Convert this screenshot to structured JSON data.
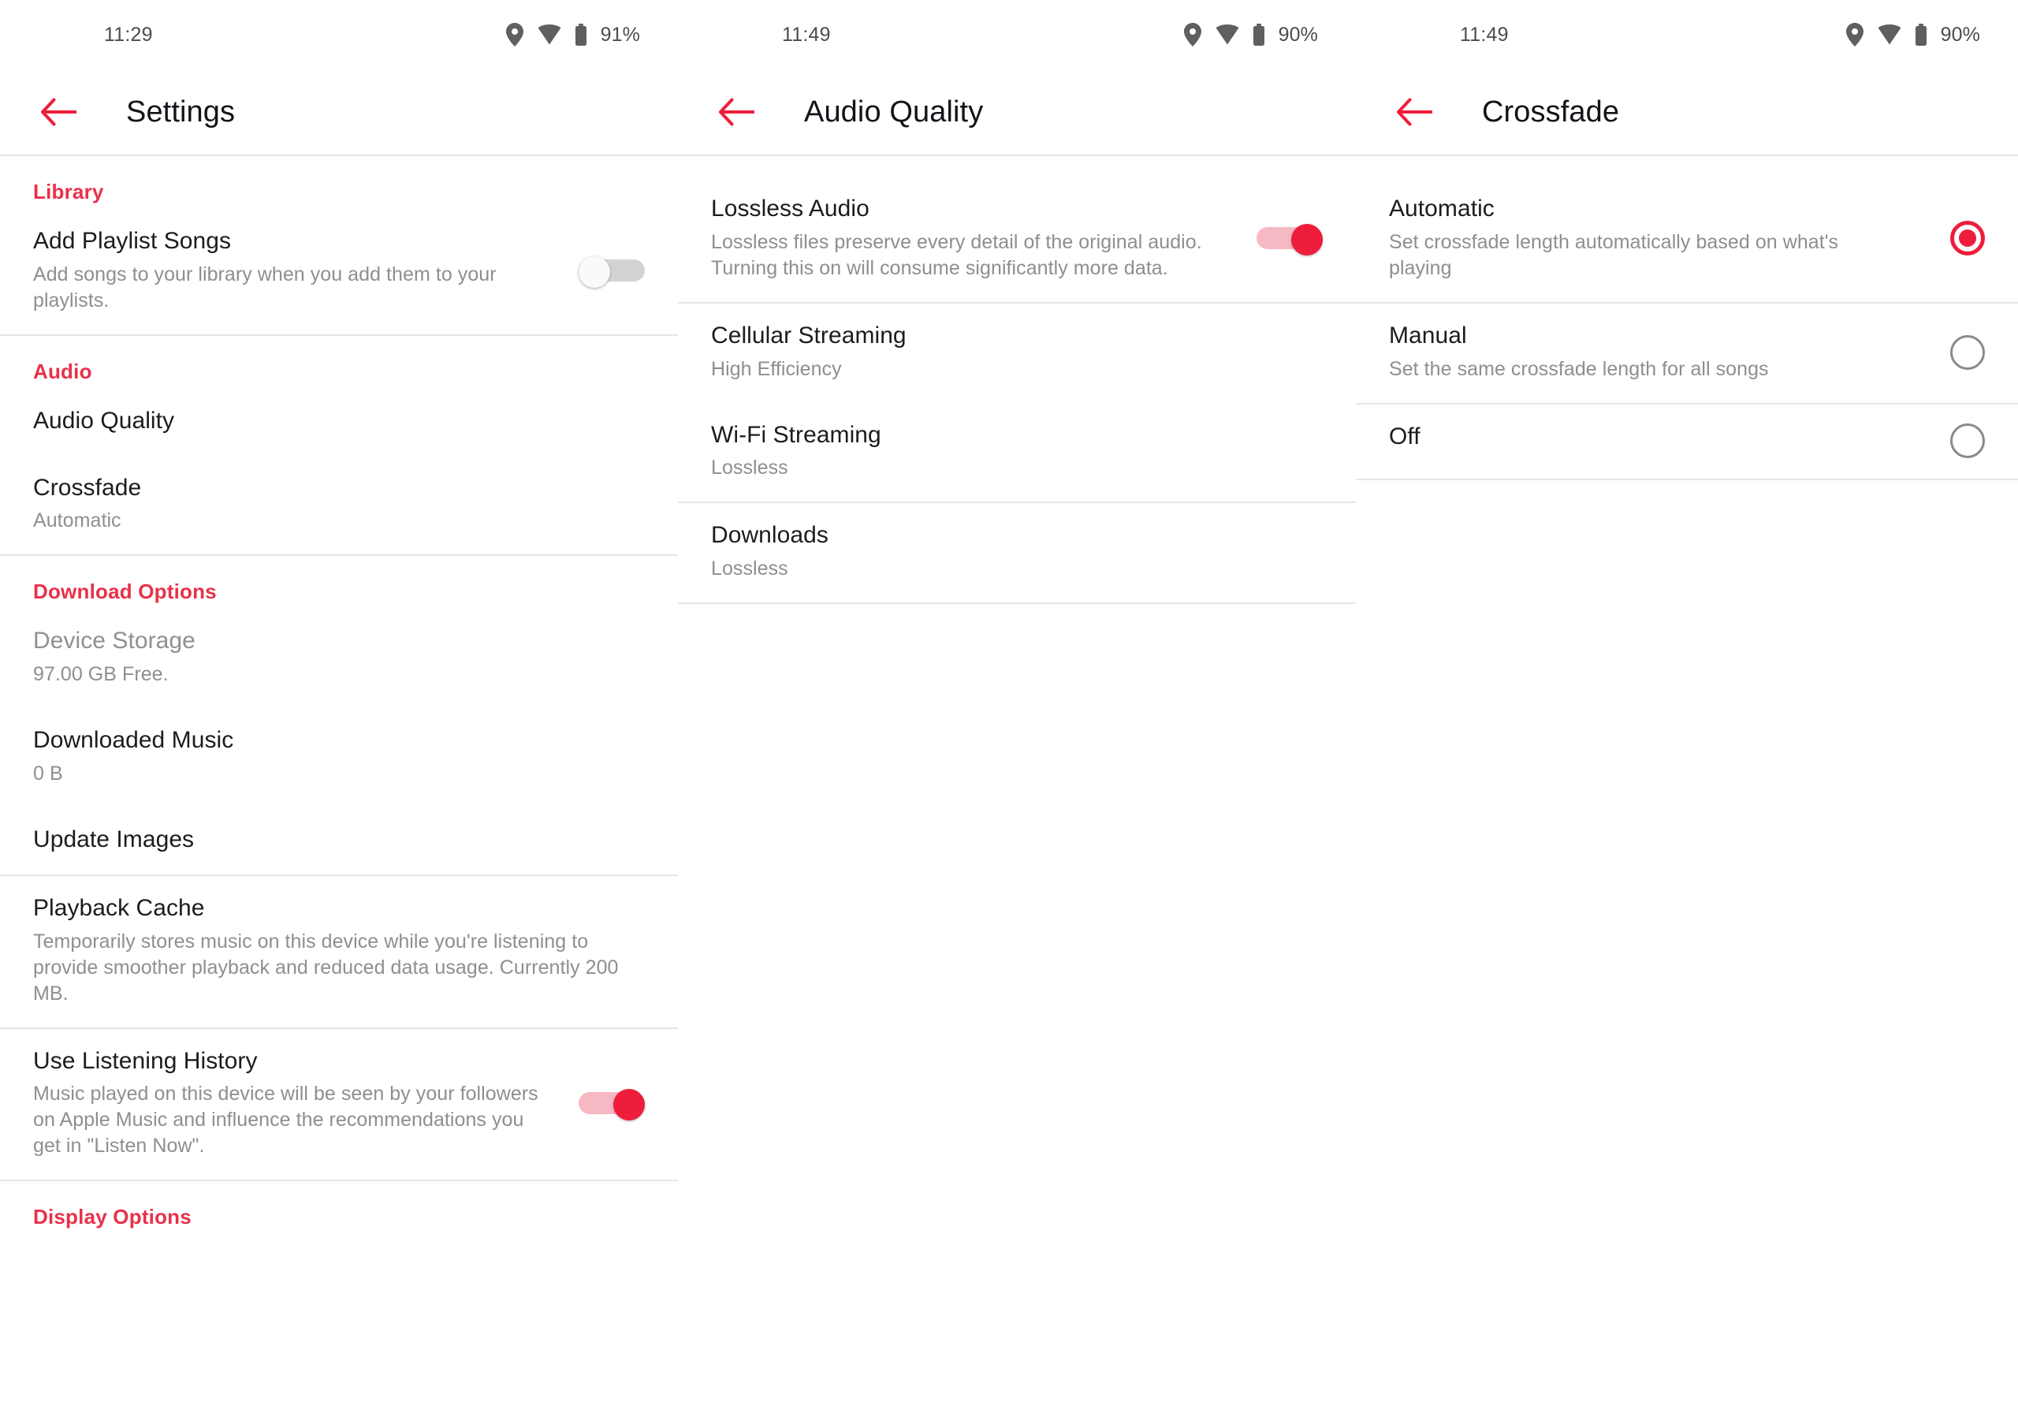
{
  "theme": {
    "accent": "#e8314a",
    "toggle_on": "#ee1d3c",
    "toggle_on_track": "#f6b9c3",
    "toggle_off_track": "#d3d3d6",
    "title_color": "#1c1c1e",
    "subtitle_color": "#8e8e93",
    "divider": "#e6e6e6",
    "background": "#ffffff"
  },
  "screens": [
    {
      "status": {
        "time": "11:29",
        "battery": "91%"
      },
      "appbar": {
        "title": "Settings",
        "back_icon": "arrow-left-icon"
      },
      "sections": [
        {
          "header": "Library",
          "rows": [
            {
              "title": "Add Playlist Songs",
              "subtitle": "Add songs to your library when you add them to your playlists.",
              "control": "toggle",
              "state": "off"
            }
          ]
        },
        {
          "header": "Audio",
          "rows": [
            {
              "title": "Audio Quality",
              "subtitle": "",
              "control": "none"
            },
            {
              "title": "Crossfade",
              "subtitle": "Automatic",
              "control": "none"
            }
          ]
        },
        {
          "header": "Download Options",
          "rows": [
            {
              "title": "Device Storage",
              "subtitle": "97.00 GB Free.",
              "control": "none",
              "muted": true
            },
            {
              "title": "Downloaded Music",
              "subtitle": "0 B",
              "control": "none"
            },
            {
              "title": "Update Images",
              "subtitle": "",
              "control": "none"
            }
          ]
        },
        {
          "header": "",
          "rows": [
            {
              "title": "Playback Cache",
              "subtitle": "Temporarily stores music on this device while you're listening to provide smoother playback and reduced data usage. Currently 200 MB.",
              "control": "none"
            },
            {
              "title": "Use Listening History",
              "subtitle": "Music played on this device will be seen by your followers on Apple Music and influence the recommendations you get in \"Listen Now\".",
              "control": "toggle",
              "state": "on"
            }
          ]
        },
        {
          "header": "Display Options",
          "rows": []
        }
      ]
    },
    {
      "status": {
        "time": "11:49",
        "battery": "90%"
      },
      "appbar": {
        "title": "Audio Quality",
        "back_icon": "arrow-left-icon"
      },
      "sections": [
        {
          "header": "",
          "rows": [
            {
              "title": "Lossless Audio",
              "subtitle": "Lossless files preserve every detail of the original audio. Turning this on will consume significantly more data.",
              "control": "toggle",
              "state": "on"
            },
            {
              "title": "Cellular Streaming",
              "subtitle": "High Efficiency",
              "control": "none"
            },
            {
              "title": "Wi-Fi Streaming",
              "subtitle": "Lossless",
              "control": "none"
            },
            {
              "title": "Downloads",
              "subtitle": "Lossless",
              "control": "none"
            }
          ]
        }
      ]
    },
    {
      "status": {
        "time": "11:49",
        "battery": "90%"
      },
      "appbar": {
        "title": "Crossfade",
        "back_icon": "arrow-left-icon"
      },
      "sections": [
        {
          "header": "",
          "rows": [
            {
              "title": "Automatic",
              "subtitle": "Set crossfade length automatically based on what's playing",
              "control": "radio",
              "state": "on"
            },
            {
              "title": "Manual",
              "subtitle": "Set the same crossfade length for all songs",
              "control": "radio",
              "state": "off"
            },
            {
              "title": "Off",
              "subtitle": "",
              "control": "radio",
              "state": "off"
            }
          ]
        }
      ]
    }
  ],
  "icons": {
    "location": "location-pin-icon",
    "wifi": "wifi-icon",
    "battery": "battery-icon",
    "back": "arrow-left-icon"
  }
}
